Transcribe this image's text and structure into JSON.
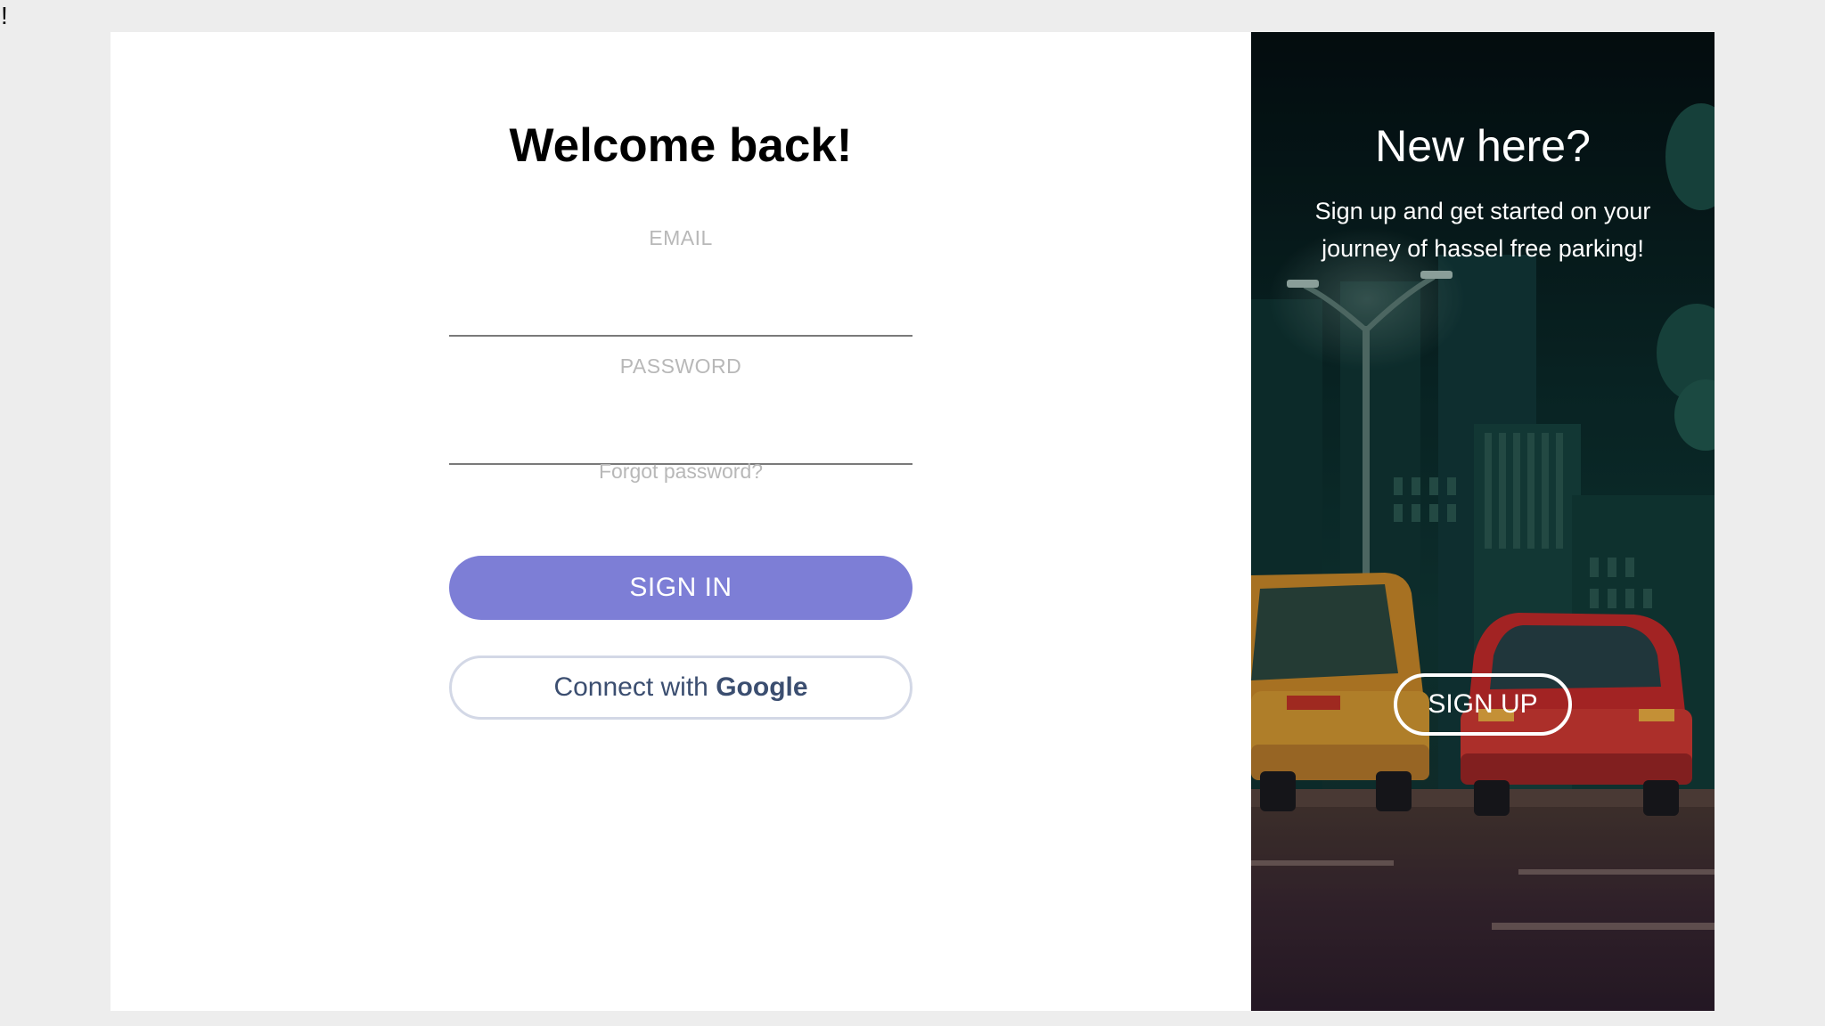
{
  "page": {
    "corner_mark": "!"
  },
  "login": {
    "title": "Welcome back!",
    "email_label": "EMAIL",
    "email_value": "",
    "password_label": "PASSWORD",
    "password_value": "",
    "forgot_link": "Forgot password?",
    "signin_button": "SIGN IN",
    "google_button_prefix": "Connect with ",
    "google_button_brand": "Google"
  },
  "signup": {
    "title": "New here?",
    "text": "Sign up and get started on your journey of hassel free parking!",
    "button": "SIGN UP"
  },
  "colors": {
    "page_bg": "#ededed",
    "card_bg": "#ffffff",
    "accent": "#7d7ed6",
    "google_text": "#3b4e70",
    "google_border": "#d3d8e6",
    "label_gray": "#b8b8b8",
    "signup_bg": "#071717"
  },
  "icons": {
    "background_scene": "night-parking-illustration"
  }
}
